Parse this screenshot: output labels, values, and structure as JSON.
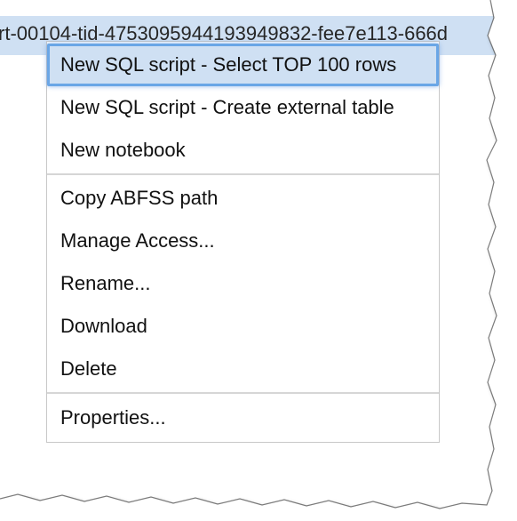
{
  "file_row": {
    "name": "rt-00104-tid-4753095944193949832-fee7e113-666d"
  },
  "context_menu": {
    "groups": [
      {
        "items": [
          {
            "label": "New SQL script - Select TOP 100 rows",
            "selected": true
          },
          {
            "label": "New SQL script - Create external table"
          },
          {
            "label": "New notebook"
          }
        ]
      },
      {
        "items": [
          {
            "label": "Copy ABFSS path"
          },
          {
            "label": "Manage Access..."
          },
          {
            "label": "Rename..."
          },
          {
            "label": "Download"
          },
          {
            "label": "Delete"
          }
        ]
      },
      {
        "items": [
          {
            "label": "Properties..."
          }
        ]
      }
    ]
  },
  "colors": {
    "selection_background": "#cfe0f3",
    "selection_outline": "#6aa6e6",
    "menu_border": "#c8c8c8"
  }
}
